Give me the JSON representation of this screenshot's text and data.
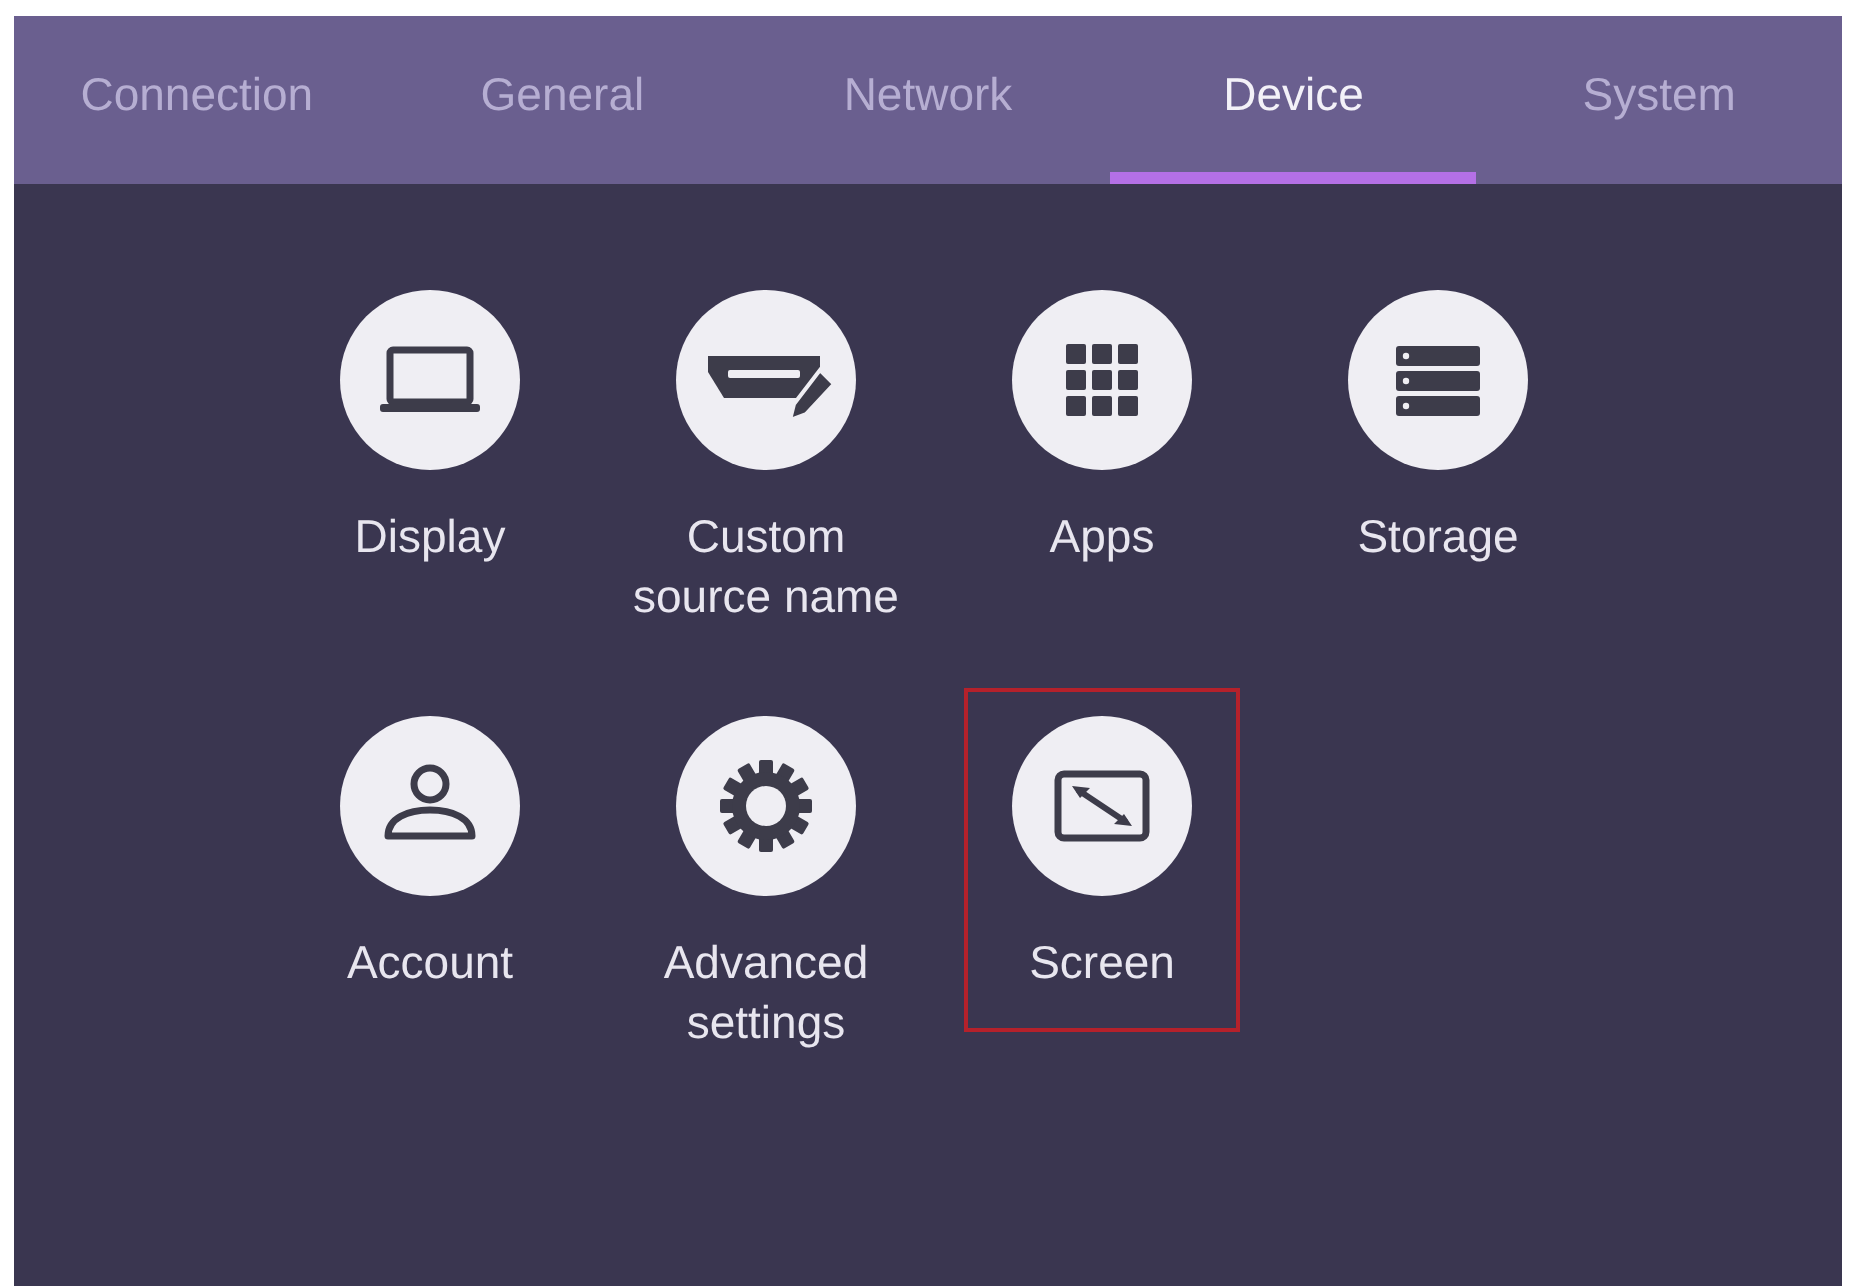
{
  "tabs": [
    {
      "label": "Connection",
      "selected": false
    },
    {
      "label": "General",
      "selected": false
    },
    {
      "label": "Network",
      "selected": false
    },
    {
      "label": "Device",
      "selected": true
    },
    {
      "label": "System",
      "selected": false
    }
  ],
  "items": [
    {
      "label": "Display",
      "highlighted": false
    },
    {
      "label": "Custom source name",
      "highlighted": false
    },
    {
      "label": "Apps",
      "highlighted": false
    },
    {
      "label": "Storage",
      "highlighted": false
    },
    {
      "label": "Account",
      "highlighted": false
    },
    {
      "label": "Advanced settings",
      "highlighted": false
    },
    {
      "label": "Screen",
      "highlighted": true
    }
  ]
}
